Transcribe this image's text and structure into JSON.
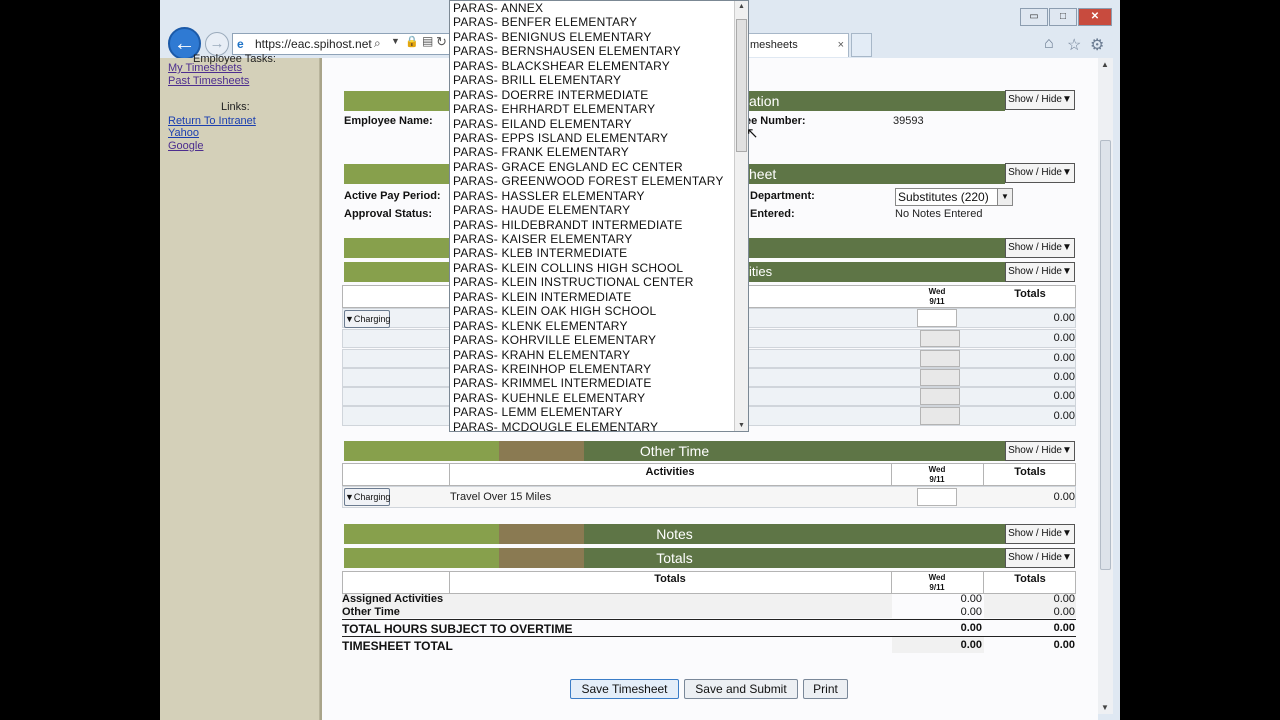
{
  "browser": {
    "url": "https://eac.spihost.net",
    "tab_label": "mesheets",
    "tab_close": "×",
    "minimize": "▭",
    "maximize": "□",
    "close": "✕"
  },
  "sidebar": {
    "employee_tasks": "Employee Tasks:",
    "my_timesheets": "My Timesheets",
    "past_timesheets": "Past Timesheets",
    "links_header": "Links:",
    "links": [
      "Return To Intranet",
      "Yahoo",
      "Google"
    ]
  },
  "employee": {
    "name_label": "Employee Name:",
    "number_label": "ee Number:",
    "number_value": "39593",
    "section_title": "ation"
  },
  "timesheet": {
    "section_title": "heet",
    "active_pay_period_label": "Active Pay Period:",
    "approval_status_label": "Approval Status:",
    "department_label": "Department:",
    "department_value": "Substitutes (220)",
    "notes_label": "Entered:",
    "notes_value": "No Notes Entered"
  },
  "assigned": {
    "title_fragment": "ities",
    "day_label": "Wed",
    "day_date": "9/11",
    "totals_label": "Totals",
    "charging": "▼Charging",
    "row_totals": [
      "0.00",
      "0.00",
      "0.00",
      "0.00",
      "0.00",
      "0.00"
    ]
  },
  "other_time": {
    "title": "Other Time",
    "activities_label": "Activities",
    "day_label": "Wed",
    "day_date": "9/11",
    "totals_label": "Totals",
    "charging": "▼Charging",
    "activity": "Travel Over 15 Miles",
    "row_total": "0.00"
  },
  "notes": {
    "title": "Notes"
  },
  "totals": {
    "title": "Totals",
    "header": "Totals",
    "day_label": "Wed",
    "day_date": "9/11",
    "totals_label": "Totals",
    "rows": [
      {
        "label": "Assigned Activities",
        "wed": "0.00",
        "total": "0.00"
      },
      {
        "label": "Other Time",
        "wed": "0.00",
        "total": "0.00"
      },
      {
        "label": "TOTAL HOURS SUBJECT TO OVERTIME",
        "wed": "0.00",
        "total": "0.00"
      },
      {
        "label": "TIMESHEET TOTAL",
        "wed": "0.00",
        "total": "0.00"
      }
    ]
  },
  "show_hide": "Show / Hide▼",
  "buttons": {
    "save": "Save Timesheet",
    "submit": "Save and Submit",
    "print": "Print"
  },
  "dropdown": {
    "items": [
      "PARAS- ANNEX",
      "PARAS- BENFER ELEMENTARY",
      "PARAS- BENIGNUS ELEMENTARY",
      "PARAS- BERNSHAUSEN ELEMENTARY",
      "PARAS- BLACKSHEAR ELEMENTARY",
      "PARAS- BRILL ELEMENTARY",
      "PARAS- DOERRE INTERMEDIATE",
      "PARAS- EHRHARDT ELEMENTARY",
      "PARAS- EILAND ELEMENTARY",
      "PARAS- EPPS ISLAND ELEMENTARY",
      "PARAS- FRANK ELEMENTARY",
      "PARAS- GRACE ENGLAND EC CENTER",
      "PARAS- GREENWOOD FOREST ELEMENTARY",
      "PARAS- HASSLER ELEMENTARY",
      "PARAS- HAUDE ELEMENTARY",
      "PARAS- HILDEBRANDT INTERMEDIATE",
      "PARAS- KAISER ELEMENTARY",
      "PARAS- KLEB INTERMEDIATE",
      "PARAS- KLEIN COLLINS HIGH SCHOOL",
      "PARAS- KLEIN INSTRUCTIONAL CENTER",
      "PARAS- KLEIN INTERMEDIATE",
      "PARAS- KLEIN OAK HIGH SCHOOL",
      "PARAS- KLENK ELEMENTARY",
      "PARAS- KOHRVILLE ELEMENTARY",
      "PARAS- KRAHN ELEMENTARY",
      "PARAS- KREINHOP ELEMENTARY",
      "PARAS- KRIMMEL INTERMEDIATE",
      "PARAS- KUEHNLE ELEMENTARY",
      "PARAS- LEMM ELEMENTARY",
      "PARAS- MCDOUGLE ELEMENTARY"
    ]
  }
}
